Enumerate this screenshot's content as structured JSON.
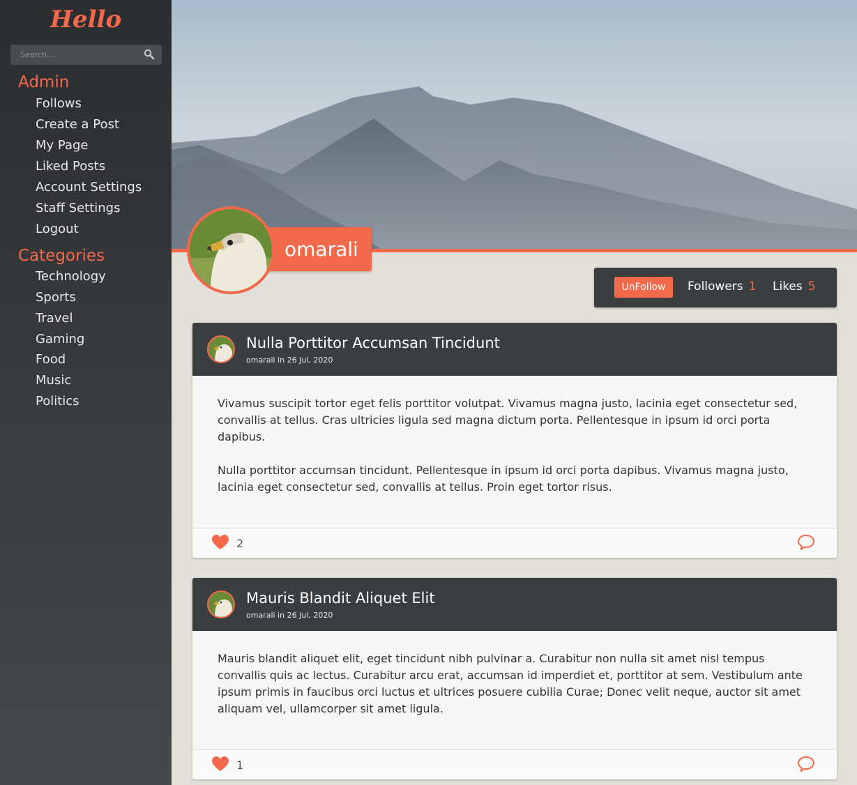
{
  "app": {
    "logo": "Hello"
  },
  "search": {
    "placeholder": "Search..."
  },
  "sidebar": {
    "admin_heading": "Admin",
    "admin_items": [
      {
        "label": "Follows"
      },
      {
        "label": "Create a Post"
      },
      {
        "label": "My Page"
      },
      {
        "label": "Liked Posts"
      },
      {
        "label": "Account Settings"
      },
      {
        "label": "Staff Settings"
      },
      {
        "label": "Logout"
      }
    ],
    "categories_heading": "Categories",
    "category_items": [
      {
        "label": "Technology"
      },
      {
        "label": "Sports"
      },
      {
        "label": "Travel"
      },
      {
        "label": "Gaming"
      },
      {
        "label": "Food"
      },
      {
        "label": "Music"
      },
      {
        "label": "Politics"
      }
    ]
  },
  "profile": {
    "username": "omarali",
    "unfollow_label": "UnFollow",
    "followers_label": "Followers",
    "followers_count": "1",
    "likes_label": "Likes",
    "likes_count": "5"
  },
  "posts": [
    {
      "title": "Nulla Porttitor Accumsan Tincidunt",
      "meta": "omarali in 26 Jul, 2020",
      "paragraphs": [
        "Vivamus suscipit tortor eget felis porttitor volutpat. Vivamus magna justo, lacinia eget consectetur sed, convallis at tellus. Cras ultricies ligula sed magna dictum porta. Pellentesque in ipsum id orci porta dapibus.",
        "Nulla porttitor accumsan tincidunt. Pellentesque in ipsum id orci porta dapibus. Vivamus magna justo, lacinia eget consectetur sed, convallis at tellus. Proin eget tortor risus."
      ],
      "likes": "2"
    },
    {
      "title": "Mauris Blandit Aliquet Elit",
      "meta": "omarali in 26 Jul, 2020",
      "paragraphs": [
        "Mauris blandit aliquet elit, eget tincidunt nibh pulvinar a. Curabitur non nulla sit amet nisl tempus convallis quis ac lectus. Curabitur arcu erat, accumsan id imperdiet et, porttitor at sem. Vestibulum ante ipsum primis in faucibus orci luctus et ultrices posuere cubilia Curae; Donec velit neque, auctor sit amet aliquam vel, ullamcorper sit amet ligula."
      ],
      "likes": "1"
    }
  ],
  "colors": {
    "accent": "#f26a4b",
    "dark_panel": "#3b3e40",
    "sidebar": "#2b2d30"
  },
  "icons": {
    "search": "search-icon",
    "like": "heart-icon",
    "comment": "comment-icon"
  }
}
